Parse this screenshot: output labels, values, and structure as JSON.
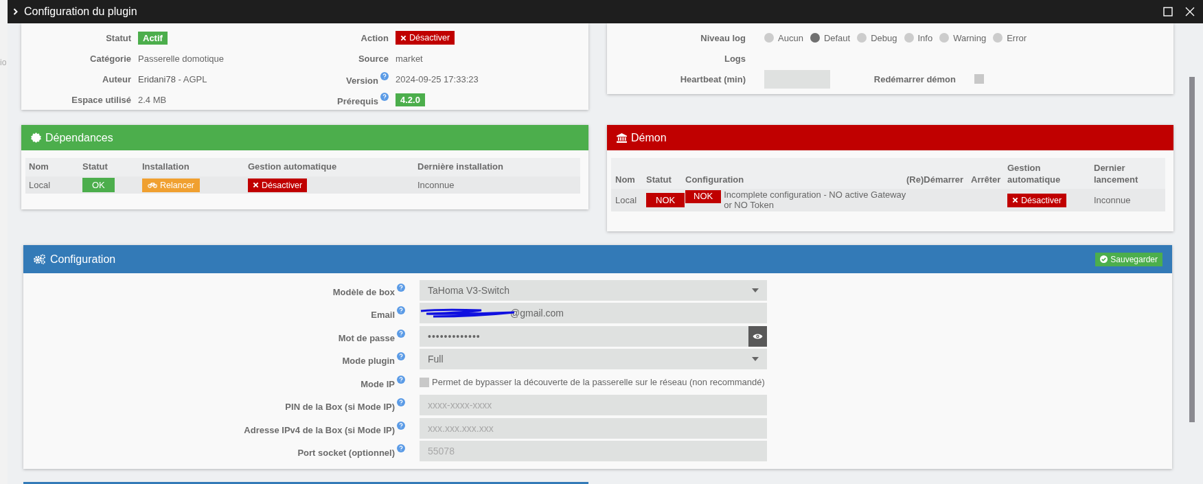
{
  "background_fragment": "io",
  "window": {
    "title": "Configuration du plugin"
  },
  "info": {
    "rows": [
      {
        "label": "Statut",
        "help": false,
        "kind": "badge",
        "value": "Actif",
        "color": "#4cae4c"
      },
      {
        "label": "Action",
        "help": false,
        "kind": "button",
        "value": "Désactiver"
      },
      {
        "label": "Catégorie",
        "help": false,
        "kind": "text",
        "value": "Passerelle domotique"
      },
      {
        "label": "Source",
        "help": false,
        "kind": "text",
        "value": "market"
      },
      {
        "label": "Auteur",
        "help": false,
        "kind": "author",
        "value": "Eridani78",
        "note": "- AGPL"
      },
      {
        "label": "Version",
        "help": true,
        "kind": "text",
        "value": "2024-09-25 17:33:23"
      },
      {
        "label": "Espace utilisé",
        "help": false,
        "kind": "text",
        "value": "2.4 MB"
      },
      {
        "label": "Prérequis",
        "help": true,
        "kind": "badge",
        "value": "4.2.0",
        "color": "#4cae4c"
      }
    ]
  },
  "logs": {
    "level_label": "Niveau log",
    "levels": [
      {
        "label": "Aucun",
        "selected": false
      },
      {
        "label": "Defaut",
        "selected": true
      },
      {
        "label": "Debug",
        "selected": false
      },
      {
        "label": "Info",
        "selected": false
      },
      {
        "label": "Warning",
        "selected": false
      },
      {
        "label": "Error",
        "selected": false
      }
    ],
    "logs_label": "Logs",
    "heartbeat_label": "Heartbeat (min)",
    "restart_label": "Redémarrer démon",
    "restart_checked": false
  },
  "dependencies": {
    "title": "Dépendances",
    "columns": [
      "Nom",
      "Statut",
      "Installation",
      "Gestion automatique",
      "Dernière installation"
    ],
    "row": [
      {
        "kind": "text",
        "text": "Local"
      },
      {
        "kind": "badge",
        "text": "OK",
        "color": "#4cae4c"
      },
      {
        "kind": "relaunch",
        "text": "Relancer"
      },
      {
        "kind": "button",
        "text": "Désactiver"
      },
      {
        "kind": "text",
        "text": "Inconnue"
      }
    ]
  },
  "daemon": {
    "title": "Démon",
    "columns": [
      "Nom",
      "Statut",
      "Configuration",
      "(Re)Démarrer",
      "Arrêter",
      "Gestion automatique",
      "Dernier lancement"
    ],
    "row": [
      {
        "kind": "text",
        "text": "Local"
      },
      {
        "kind": "badge",
        "text": "NOK",
        "color": "#c00000"
      },
      {
        "kind": "config",
        "text": "NOK",
        "color": "#c00000",
        "message": "Incomplete configuration - NO active Gateway or NO Token"
      },
      {
        "kind": "empty"
      },
      {
        "kind": "empty"
      },
      {
        "kind": "button",
        "text": "Désactiver"
      },
      {
        "kind": "text",
        "text": "Inconnue"
      }
    ]
  },
  "configuration": {
    "title": "Configuration",
    "save": "Sauvegarder",
    "fields": [
      {
        "label": "Modèle de box",
        "kind": "select",
        "value": "TaHoma V3-Switch"
      },
      {
        "label": "Email",
        "kind": "redacted",
        "value": "@gmail.com"
      },
      {
        "label": "Mot de passe",
        "kind": "password",
        "value": "•••••••••••••"
      },
      {
        "label": "Mode plugin",
        "kind": "select",
        "value": "Full"
      },
      {
        "label": "Mode IP",
        "kind": "checkbox",
        "checked": false,
        "text": "Permet de bypasser la découverte de la passerelle sur le réseau (non recommandé)"
      },
      {
        "label": "PIN de la Box (si Mode IP)",
        "kind": "text",
        "placeholder": "xxxx-xxxx-xxxx"
      },
      {
        "label": "Adresse IPv4 de la Box (si Mode IP)",
        "kind": "text",
        "placeholder": "xxx.xxx.xxx.xxx"
      },
      {
        "label": "Port socket (optionnel)",
        "kind": "text",
        "placeholder": "55078"
      }
    ]
  }
}
